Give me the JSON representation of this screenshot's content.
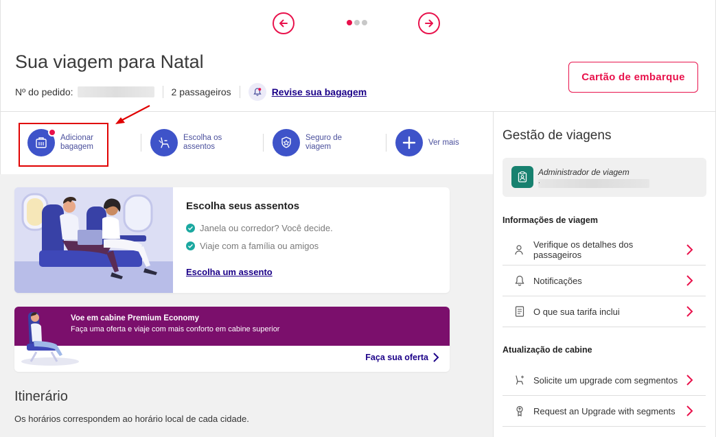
{
  "carousel": {
    "dots": [
      true,
      false,
      false
    ]
  },
  "header": {
    "title": "Sua viagem para Natal",
    "order_label": "Nº do pedido:",
    "passengers": "2 passageiros",
    "review_link": "Revise sua bagagem",
    "boarding_button": "Cartão de embarque"
  },
  "quick_actions": [
    {
      "label": "Adicionar bagagem",
      "icon": "luggage-icon"
    },
    {
      "label": "Escolha os assentos",
      "icon": "seat-icon"
    },
    {
      "label": "Seguro de viagem",
      "icon": "shield-icon"
    },
    {
      "label": "Ver mais",
      "icon": "plus-icon"
    }
  ],
  "seat_card": {
    "title": "Escolha seus assentos",
    "bullets": [
      "Janela ou corredor? Você decide.",
      "Viaje com a família ou amigos"
    ],
    "link": "Escolha um assento"
  },
  "premium_card": {
    "title": "Voe em cabine Premium Economy",
    "subtitle": "Faça uma oferta e viaje com mais conforto em cabine superior",
    "link": "Faça sua oferta"
  },
  "itinerary": {
    "title": "Itinerário",
    "subtitle": "Os horários correspondem ao horário local de cada cidade."
  },
  "sidebar": {
    "title": "Gestão de viagens",
    "admin_label": "Administrador de viagem",
    "admin_value": ".",
    "section_info": "Informações de viagem",
    "info_items": [
      {
        "label": "Verifique os detalhes dos passageiros",
        "icon": "person-icon"
      },
      {
        "label": "Notificações",
        "icon": "bell-icon"
      },
      {
        "label": "O que sua tarifa inclui",
        "icon": "document-icon"
      }
    ],
    "section_cabin": "Atualização de cabine",
    "cabin_items": [
      {
        "label": "Solicite um upgrade com segmentos",
        "icon": "seat-upgrade-icon"
      },
      {
        "label": "Request an Upgrade with segments",
        "icon": "upgrade-badge-icon"
      }
    ]
  },
  "colors": {
    "brand_red": "#e8114b",
    "brand_blue": "#3e53c9",
    "link_navy": "#1b0088",
    "premium_purple": "#7b0f6c",
    "teal": "#1ba8a0"
  }
}
